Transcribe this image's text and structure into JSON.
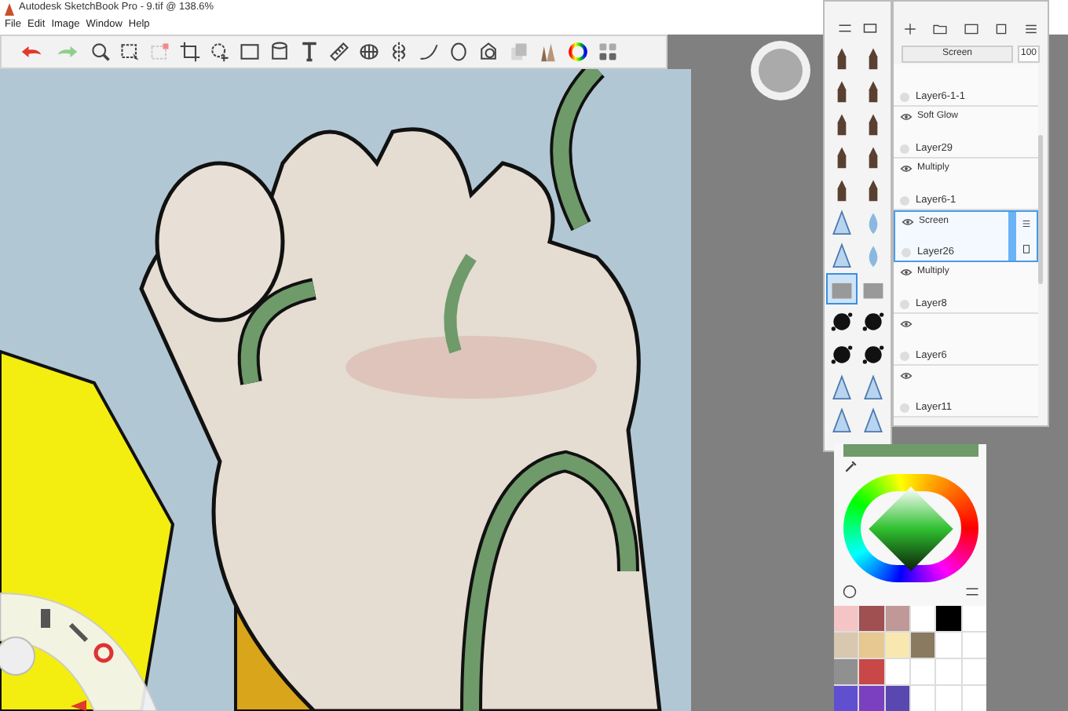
{
  "window": {
    "title": "Autodesk SketchBook Pro - 9.tif @ 138.6%"
  },
  "menu": [
    "File",
    "Edit",
    "Image",
    "Window",
    "Help"
  ],
  "brushes": [
    {
      "selected": false
    },
    {
      "selected": false
    },
    {
      "selected": false
    },
    {
      "selected": false
    },
    {
      "selected": false
    },
    {
      "selected": false
    },
    {
      "selected": false
    },
    {
      "selected": false
    },
    {
      "selected": false
    },
    {
      "selected": false
    },
    {
      "selected": false
    },
    {
      "selected": false
    },
    {
      "selected": false
    },
    {
      "selected": false
    },
    {
      "selected": true
    },
    {
      "selected": false
    },
    {
      "selected": false
    },
    {
      "selected": false
    },
    {
      "selected": false
    },
    {
      "selected": false
    },
    {
      "selected": false
    },
    {
      "selected": false
    },
    {
      "selected": false
    },
    {
      "selected": false
    }
  ],
  "layers_panel": {
    "blend_mode": "Screen",
    "opacity": "100",
    "layers": [
      {
        "name": "Layer6-1-1",
        "visible": false,
        "selected": false
      },
      {
        "blend": "Soft Glow",
        "name": "Layer29",
        "visible": true,
        "selected": false
      },
      {
        "blend": "Multiply",
        "name": "Layer6-1",
        "visible": true,
        "selected": false
      },
      {
        "blend": "Screen",
        "name": "Layer26",
        "visible": true,
        "selected": true
      },
      {
        "blend": "Multiply",
        "name": "Layer8",
        "visible": true,
        "selected": false
      },
      {
        "name": "Layer6",
        "visible": true,
        "selected": false
      },
      {
        "name": "Layer11",
        "visible": true,
        "selected": false
      }
    ]
  },
  "color_panel": {
    "current": {
      "color": "#6f9a6a"
    },
    "swatches": [
      {
        "color": "#f5c4c4"
      },
      {
        "color": "#a05050"
      },
      {
        "color": "#c09898"
      },
      {
        "color": "#ffffff"
      },
      {
        "color": "#000000"
      },
      {
        "color": "#ffffff"
      },
      {
        "color": "#d8c8b0"
      },
      {
        "color": "#e6c890"
      },
      {
        "color": "#f8e8b0"
      },
      {
        "color": "#8a7a60"
      },
      {
        "color": "#ffffff"
      },
      {
        "color": "#ffffff"
      },
      {
        "color": "#909090"
      },
      {
        "color": "#c84848"
      },
      {
        "color": "#ffffff"
      },
      {
        "color": "#ffffff"
      },
      {
        "color": "#ffffff"
      },
      {
        "color": "#ffffff"
      },
      {
        "color": "#6050d0"
      },
      {
        "color": "#7a40c0"
      },
      {
        "color": "#5848b0"
      },
      {
        "color": "#ffffff"
      },
      {
        "color": "#ffffff"
      },
      {
        "color": "#ffffff"
      }
    ]
  }
}
